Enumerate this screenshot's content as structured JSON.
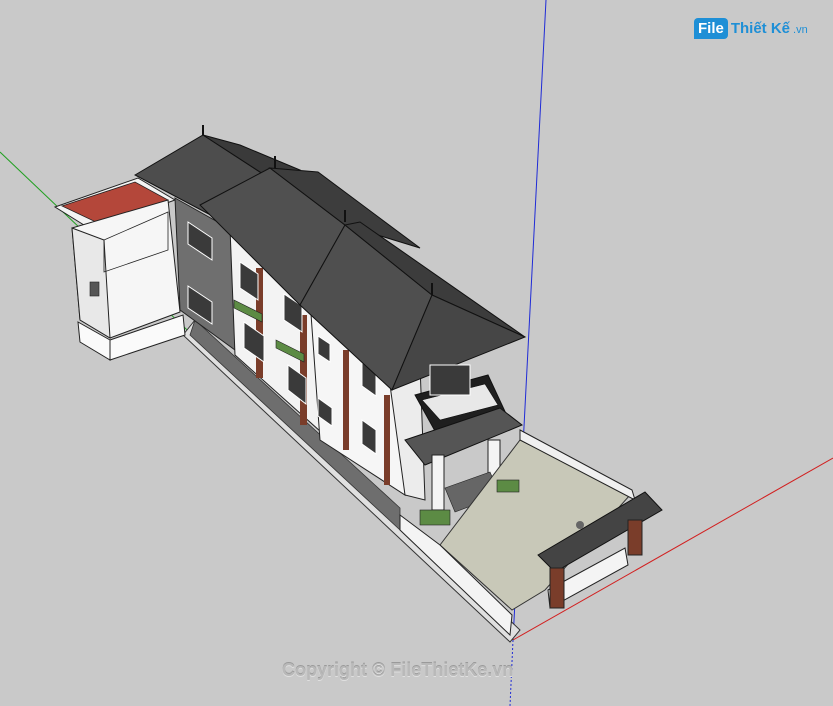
{
  "watermark": {
    "badge": "File",
    "name": "Thiết Kế",
    "suffix": ".vn",
    "copyright": "Copyright © FileThietKe.vn"
  },
  "colors": {
    "background": "#c9c9c9",
    "roof": "#4a4a4a",
    "wall": "#f2f2f2",
    "red_axis": "#d22020",
    "green_axis": "#22a022",
    "blue_axis": "#1f2bd6",
    "accent_roof_red": "#b4473a"
  }
}
